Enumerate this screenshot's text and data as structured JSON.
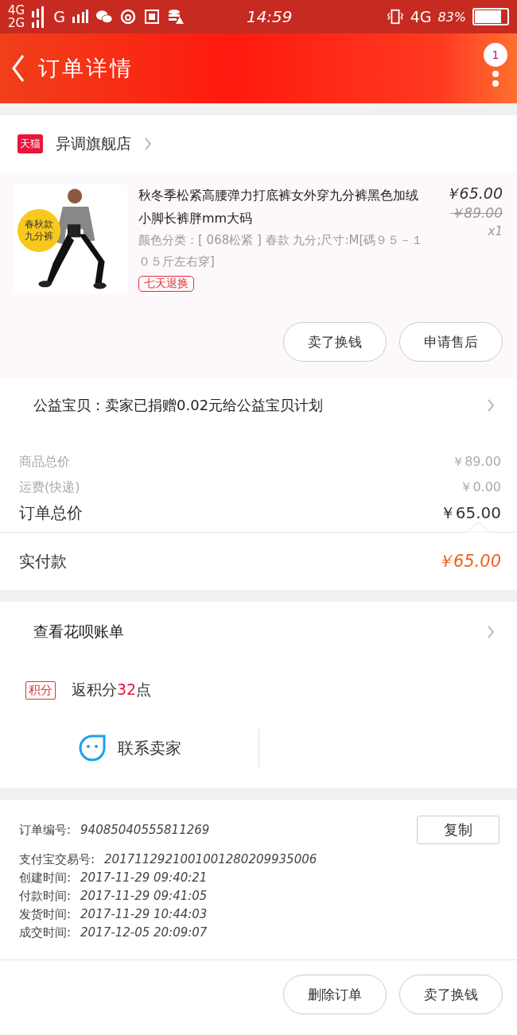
{
  "status_bar": {
    "network_1": "4G",
    "network_2": "2G",
    "network_3": "G",
    "time": "14:59",
    "network_4": "4G",
    "battery": "83%"
  },
  "header": {
    "title": "订单详情",
    "badge": "1"
  },
  "store": {
    "tag": "天猫",
    "name": "异调旗舰店"
  },
  "product": {
    "sticker_1": "春秋款",
    "sticker_2": "九分裤",
    "title": "秋冬季松紧高腰弹力打底裤女外穿九分裤黑色加绒小脚长裤胖mm大码",
    "sku": "颜色分类：[ 068松紧 ] 春款  九分;尺寸:M[碼９５－１０５斤左右穿]",
    "tag": "七天退换",
    "price": "￥65.00",
    "original_price": "￥89.00",
    "quantity": "x1",
    "buttons": [
      "卖了换钱",
      "申请售后"
    ]
  },
  "charity": {
    "text": "公益宝贝：卖家已捐赠0.02元给公益宝贝计划"
  },
  "summary": [
    {
      "label": "商品总价",
      "value": "￥89.00",
      "kind": "minor"
    },
    {
      "label": "运费(快递)",
      "value": "￥0.00",
      "kind": "minor"
    },
    {
      "label": "订单总价",
      "value": "￥65.00",
      "kind": "major"
    }
  ],
  "paid": {
    "label": "实付款",
    "value": "￥65.00"
  },
  "huabei": {
    "text": "查看花呗账单"
  },
  "points": {
    "tag": "积分",
    "prefix": "返积分",
    "count": "32",
    "suffix": "点"
  },
  "contact": {
    "label": "联系卖家"
  },
  "info": {
    "order_no_label": "订单编号:",
    "order_no": "94085040555811269",
    "copy": "复制",
    "rows": [
      {
        "label": "支付宝交易号:",
        "value": "2017112921001001280209935006"
      },
      {
        "label": "创建时间:",
        "value": "2017-11-29 09:40:21"
      },
      {
        "label": "付款时间:",
        "value": "2017-11-29 09:41:05"
      },
      {
        "label": "发货时间:",
        "value": "2017-11-29 10:44:03"
      },
      {
        "label": "成交时间:",
        "value": "2017-12-05 20:09:07"
      }
    ]
  },
  "footer_buttons": [
    "删除订单",
    "卖了换钱"
  ]
}
